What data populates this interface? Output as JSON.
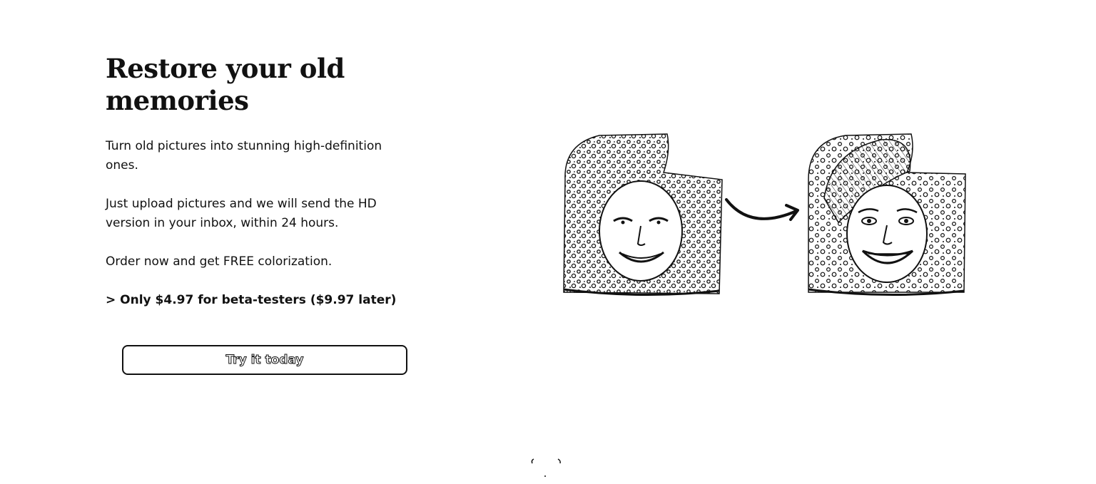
{
  "hero": {
    "title": "Restore your old memories",
    "paragraphs": [
      "Turn old pictures into stunning high-definition ones.",
      "Just upload pictures and we will send the HD version in your inbox, within 24 hours.",
      "Order now and get FREE colorization."
    ],
    "price_line": "> Only $4.97 for beta-testers ($9.97 later)",
    "cta_label": "Try it today"
  },
  "illustration": {
    "before_image": "old-photo-icon",
    "arrow_icon": "curved-arrow-right-icon",
    "after_image": "restored-photo-icon"
  },
  "colors": {
    "text": "#111111",
    "background": "#ffffff"
  }
}
